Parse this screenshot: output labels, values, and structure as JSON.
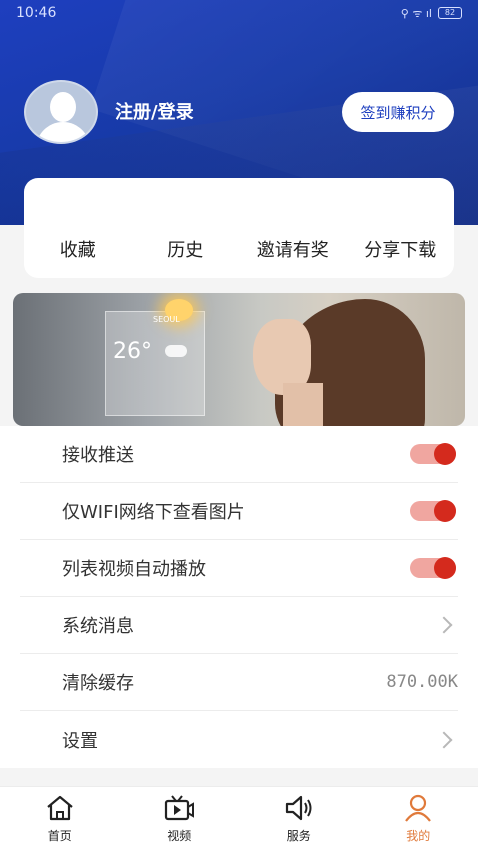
{
  "status_bar": {
    "time": "10:46",
    "signal": "⚲ ᯤ ıl",
    "battery": "82"
  },
  "profile": {
    "login_label": "注册/登录",
    "signin_button": "签到赚积分"
  },
  "quick_actions": [
    {
      "label": "收藏"
    },
    {
      "label": "历史"
    },
    {
      "label": "邀请有奖"
    },
    {
      "label": "分享下载"
    }
  ],
  "banner": {
    "city": "SEOUL",
    "temperature": "26°"
  },
  "settings": {
    "push": {
      "label": "接收推送",
      "enabled": true
    },
    "wifi_images": {
      "label": "仅WIFI网络下查看图片",
      "enabled": true
    },
    "autoplay": {
      "label": "列表视频自动播放",
      "enabled": true
    },
    "messages": {
      "label": "系统消息"
    },
    "cache": {
      "label": "清除缓存",
      "value": "870.00K"
    },
    "settings": {
      "label": "设置"
    }
  },
  "tabs": [
    {
      "label": "首页",
      "icon": "home-icon"
    },
    {
      "label": "视频",
      "icon": "video-icon"
    },
    {
      "label": "服务",
      "icon": "speaker-icon"
    },
    {
      "label": "我的",
      "icon": "user-icon",
      "active": true
    }
  ],
  "colors": {
    "primary_blue": "#1e3fbf",
    "toggle_on": "#d42a1d",
    "active_tab": "#e07a3b"
  }
}
